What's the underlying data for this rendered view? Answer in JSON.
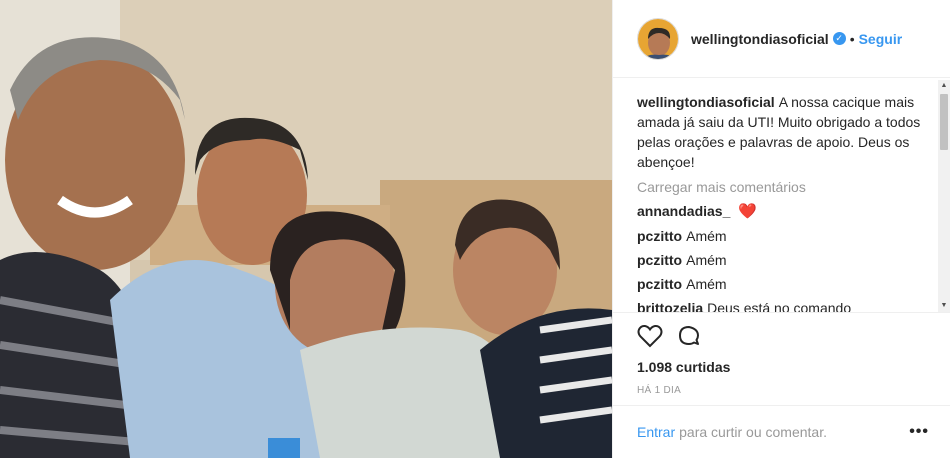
{
  "post": {
    "author": "wellingtondiasoficial",
    "follow_label": "Seguir",
    "separator": "•",
    "verified_icon": "verified-badge-icon",
    "caption": "A nossa cacique mais amada já saiu da UTI! Muito obrigado a todos pelas orações e palavras de apoio. Deus os abençoe!",
    "load_more": "Carregar mais comentários",
    "comments": [
      {
        "user": "annandadias_",
        "text": "❤️"
      },
      {
        "user": "pczitto",
        "text": "Amém"
      },
      {
        "user": "pczitto",
        "text": "Amém"
      },
      {
        "user": "pczitto",
        "text": "Amém"
      },
      {
        "user": "brittozelia",
        "text": "Deus está no comando"
      }
    ],
    "likes": "1.098 curtidas",
    "date": "HÁ 1 DIA",
    "login_link": "Entrar",
    "login_prompt": "para curtir ou comentar.",
    "more_label": "•••"
  },
  "colors": {
    "link_blue": "#3897f0",
    "heart_red": "#ed4956",
    "muted": "#999999"
  }
}
